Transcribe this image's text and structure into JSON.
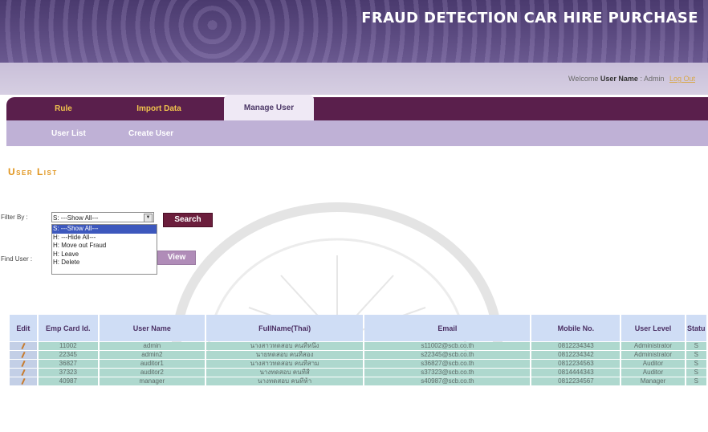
{
  "app": {
    "title": "FRAUD DETECTION CAR HIRE PURCHASE"
  },
  "header": {
    "welcome_prefix": "Welcome",
    "user_name_label": "User Name",
    "user_name_value": ": Admin",
    "logout_label": "Log Out"
  },
  "tabs": [
    {
      "label": "Rule",
      "active": false
    },
    {
      "label": "Import Data",
      "active": false
    },
    {
      "label": "Manage User",
      "active": true
    }
  ],
  "subnav": [
    {
      "label": "User List"
    },
    {
      "label": "Create User"
    }
  ],
  "page": {
    "heading": "User List"
  },
  "filter": {
    "label": "Filter By :",
    "selected": "S: ---Show All---",
    "options": [
      "S: ---Show All---",
      "H: ---Hide All---",
      "H: Move out Fraud",
      "H: Leave",
      "H: Delete"
    ],
    "search_label": "Search"
  },
  "find": {
    "label": "Find User :",
    "view_label": "View"
  },
  "table": {
    "columns": [
      "Edit",
      "Emp Card Id.",
      "User Name",
      "FullName(Thai)",
      "Email",
      "Mobile No.",
      "User Level",
      "Statu"
    ],
    "rows": [
      [
        "",
        "11002",
        "admin",
        "นางสาวทดสอบ คนที่หนึ่ง",
        "s11002@scb.co.th",
        "0812234343",
        "Administrator",
        "S"
      ],
      [
        "",
        "22345",
        "admin2",
        "นายทดสอบ คนที่สอง",
        "s22345@scb.co.th",
        "0812234342",
        "Administrator",
        "S"
      ],
      [
        "",
        "36827",
        "auditor1",
        "นางสาวทดสอบ คนที่สาม",
        "s36827@scb.co.th",
        "0812234563",
        "Auditor",
        "S"
      ],
      [
        "",
        "37323",
        "auditor2",
        "นางทดสอบ คนที่สี่",
        "s37323@scb.co.th",
        "0814444343",
        "Auditor",
        "S"
      ],
      [
        "",
        "40987",
        "manager",
        "นางทดสอบ คนที่ห้า",
        "s40987@scb.co.th",
        "0812234567",
        "Manager",
        "S"
      ]
    ]
  },
  "colors": {
    "tab_bar": "#5a1f4c",
    "tab_text": "#f1c44d",
    "heading": "#e0941c",
    "header_cell": "#cfddf5",
    "row_cell": "#aed8ce"
  }
}
